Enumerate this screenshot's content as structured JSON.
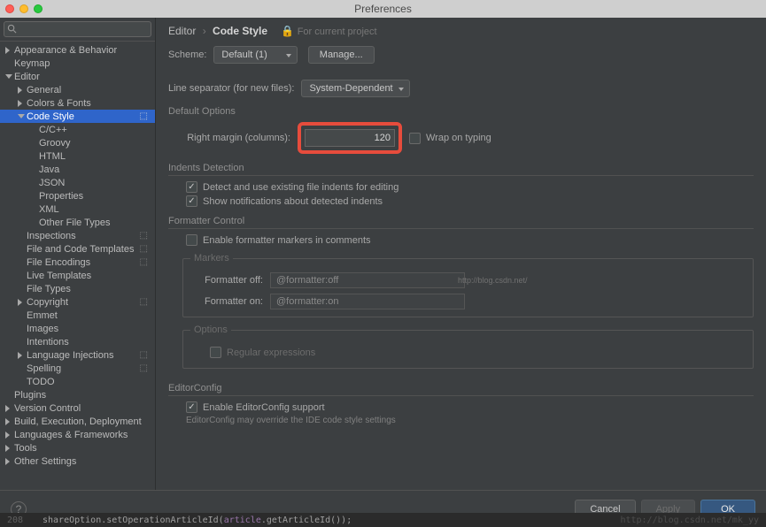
{
  "window": {
    "title": "Preferences"
  },
  "sidebar": {
    "search_placeholder": "",
    "items": [
      {
        "label": "Appearance & Behavior",
        "depth": 0,
        "arrow": "right"
      },
      {
        "label": "Keymap",
        "depth": 0,
        "arrow": "none"
      },
      {
        "label": "Editor",
        "depth": 0,
        "arrow": "down"
      },
      {
        "label": "General",
        "depth": 1,
        "arrow": "right"
      },
      {
        "label": "Colors & Fonts",
        "depth": 1,
        "arrow": "right"
      },
      {
        "label": "Code Style",
        "depth": 1,
        "arrow": "down",
        "selected": true,
        "gear": true
      },
      {
        "label": "C/C++",
        "depth": 2,
        "arrow": "none"
      },
      {
        "label": "Groovy",
        "depth": 2,
        "arrow": "none"
      },
      {
        "label": "HTML",
        "depth": 2,
        "arrow": "none"
      },
      {
        "label": "Java",
        "depth": 2,
        "arrow": "none"
      },
      {
        "label": "JSON",
        "depth": 2,
        "arrow": "none"
      },
      {
        "label": "Properties",
        "depth": 2,
        "arrow": "none"
      },
      {
        "label": "XML",
        "depth": 2,
        "arrow": "none"
      },
      {
        "label": "Other File Types",
        "depth": 2,
        "arrow": "none"
      },
      {
        "label": "Inspections",
        "depth": 1,
        "arrow": "none",
        "gear": true
      },
      {
        "label": "File and Code Templates",
        "depth": 1,
        "arrow": "none",
        "gear": true
      },
      {
        "label": "File Encodings",
        "depth": 1,
        "arrow": "none",
        "gear": true
      },
      {
        "label": "Live Templates",
        "depth": 1,
        "arrow": "none"
      },
      {
        "label": "File Types",
        "depth": 1,
        "arrow": "none"
      },
      {
        "label": "Copyright",
        "depth": 1,
        "arrow": "right",
        "gear": true
      },
      {
        "label": "Emmet",
        "depth": 1,
        "arrow": "none"
      },
      {
        "label": "Images",
        "depth": 1,
        "arrow": "none"
      },
      {
        "label": "Intentions",
        "depth": 1,
        "arrow": "none"
      },
      {
        "label": "Language Injections",
        "depth": 1,
        "arrow": "right",
        "gear": true
      },
      {
        "label": "Spelling",
        "depth": 1,
        "arrow": "none",
        "gear": true
      },
      {
        "label": "TODO",
        "depth": 1,
        "arrow": "none"
      },
      {
        "label": "Plugins",
        "depth": 0,
        "arrow": "none"
      },
      {
        "label": "Version Control",
        "depth": 0,
        "arrow": "right"
      },
      {
        "label": "Build, Execution, Deployment",
        "depth": 0,
        "arrow": "right"
      },
      {
        "label": "Languages & Frameworks",
        "depth": 0,
        "arrow": "right"
      },
      {
        "label": "Tools",
        "depth": 0,
        "arrow": "right"
      },
      {
        "label": "Other Settings",
        "depth": 0,
        "arrow": "right"
      }
    ]
  },
  "breadcrumb": {
    "root": "Editor",
    "current": "Code Style",
    "scope": "For current project"
  },
  "scheme": {
    "label": "Scheme:",
    "value": "Default (1)",
    "manage": "Manage..."
  },
  "lineSep": {
    "label": "Line separator (for new files):",
    "value": "System-Dependent"
  },
  "defaultOptions": {
    "title": "Default Options",
    "rightMarginLabel": "Right margin (columns):",
    "rightMarginValue": "120",
    "wrapLabel": "Wrap on typing",
    "wrapChecked": false
  },
  "indents": {
    "title": "Indents Detection",
    "detect": {
      "label": "Detect and use existing file indents for editing",
      "checked": true
    },
    "notify": {
      "label": "Show notifications about detected indents",
      "checked": true
    }
  },
  "formatter": {
    "title": "Formatter Control",
    "enable": {
      "label": "Enable formatter markers in comments",
      "checked": false
    },
    "markersTitle": "Markers",
    "offLabel": "Formatter off:",
    "offValue": "@formatter:off",
    "onLabel": "Formatter on:",
    "onValue": "@formatter:on",
    "optionsTitle": "Options",
    "regex": {
      "label": "Regular expressions",
      "checked": false
    },
    "watermark": "http://blog.csdn.net/"
  },
  "editorConfig": {
    "title": "EditorConfig",
    "enable": {
      "label": "Enable EditorConfig support",
      "checked": true
    },
    "hint": "EditorConfig may override the IDE code style settings"
  },
  "footer": {
    "cancel": "Cancel",
    "apply": "Apply",
    "ok": "OK"
  },
  "codebar": {
    "line": "208",
    "code_pre": "shareOption.setOperationArticleId(",
    "code_var": "article",
    "code_mid": ".getArticleId());",
    "wm": "http://blog.csdn.net/mk_yy"
  }
}
